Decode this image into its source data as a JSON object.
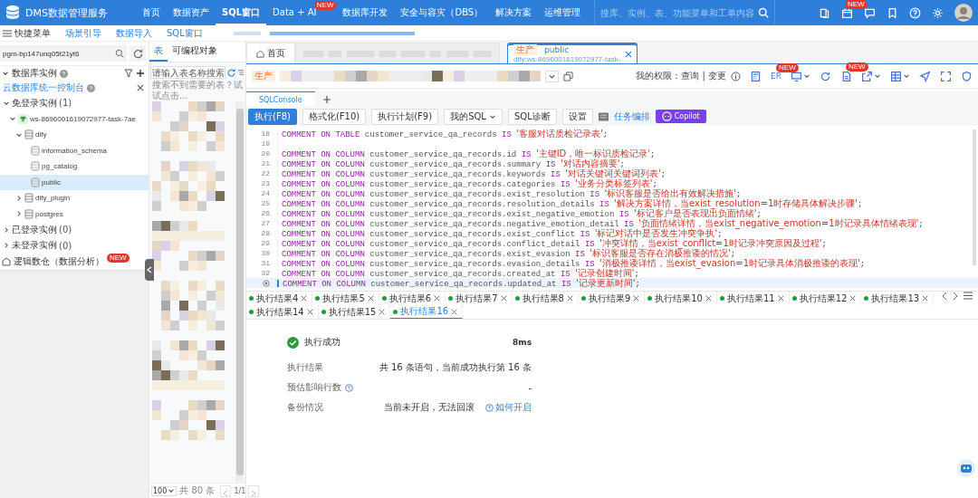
{
  "header": {
    "product": "DMS数据管理服务",
    "nav": [
      {
        "label": "首页",
        "selected": false
      },
      {
        "label": "数据资产",
        "selected": false
      },
      {
        "label": "SQL窗口",
        "selected": true
      },
      {
        "label": "Data + AI",
        "selected": false,
        "badge": "NEW"
      },
      {
        "label": "数据库开发",
        "selected": false
      },
      {
        "label": "安全与容灾（DBS）",
        "selected": false
      },
      {
        "label": "解决方案",
        "selected": false
      },
      {
        "label": "运维管理",
        "selected": false
      }
    ],
    "search": {
      "placeholder": "搜库、实例、表、功能菜单和工单内容"
    },
    "tools": [
      {
        "kind": "book"
      },
      {
        "kind": "calendar",
        "badge": "NEW"
      },
      {
        "kind": "chat"
      },
      {
        "kind": "bookmark"
      },
      {
        "kind": "help"
      },
      {
        "kind": "settings"
      }
    ]
  },
  "quickbar": {
    "menu": "快捷菜单",
    "links": [
      "场景引导",
      "数据导入",
      "SQL窗口"
    ]
  },
  "instance_picker": {
    "value": "pgm-bp147unq05t21yt6"
  },
  "instances": {
    "title": "数据库实例",
    "console_link": "云数据库统一控制台",
    "tree": [
      {
        "kind": "group",
        "label": "免登录实例",
        "count": "(1)",
        "expanded": true,
        "children": [
          {
            "kind": "instance",
            "label": "ws-8696001619072977-task-7ae",
            "expanded": true,
            "children": [
              {
                "kind": "database",
                "label": "dify",
                "expanded": true,
                "children": [
                  {
                    "kind": "schema",
                    "label": "information_schema",
                    "selected": false
                  },
                  {
                    "kind": "schema",
                    "label": "pg_catalog",
                    "selected": false
                  },
                  {
                    "kind": "schema",
                    "label": "public",
                    "selected": true
                  }
                ]
              },
              {
                "kind": "database",
                "label": "dify_plugin",
                "expanded": false
              },
              {
                "kind": "database",
                "label": "postgres",
                "expanded": false
              }
            ]
          }
        ]
      },
      {
        "kind": "group",
        "label": "已登录实例",
        "count": "(0)",
        "expanded": false
      },
      {
        "kind": "group",
        "label": "未登录实例",
        "count": "(0)",
        "expanded": false
      }
    ],
    "logical_warehouse": {
      "label": "逻辑数仓（数据分析）",
      "badge": "NEW"
    }
  },
  "tables": {
    "tabs": [
      {
        "label": "表",
        "selected": true
      },
      {
        "label": "可编程对象",
        "selected": false
      }
    ],
    "search": {
      "placeholder": "请输入表名称搜索"
    },
    "hint": "搜索不到需要的表？试试点击...",
    "page_size": "100",
    "total": "共 80 条",
    "page": "1/1"
  },
  "workspace_tabs": [
    {
      "kind": "home",
      "label": "首页",
      "selected": false
    },
    {
      "kind": "blurred",
      "selected": false
    },
    {
      "kind": "console",
      "env": "生产",
      "label": "public",
      "subtitle": "dify:ws-8696001619072977-task-",
      "selected": true
    }
  ],
  "context_bar": {
    "env": "生产",
    "permissions": "我的权限：查询 | 变更",
    "tools": [
      {
        "kind": "calculator",
        "dropdown": false
      },
      {
        "kind": "er",
        "label": "ER",
        "badge": "NEW",
        "dropdown": false
      },
      {
        "kind": "monitor",
        "dropdown": true
      },
      {
        "kind": "refresh",
        "dropdown": false
      },
      {
        "kind": "document",
        "badge": "NEW",
        "dropdown": false
      },
      {
        "kind": "export",
        "dropdown": true
      },
      {
        "kind": "table",
        "dropdown": true
      },
      {
        "kind": "send",
        "dropdown": false
      },
      {
        "kind": "fullscreen",
        "dropdown": false
      },
      {
        "kind": "shield",
        "dropdown": false
      }
    ]
  },
  "editor_tabs": [
    {
      "label": "SQLConsole",
      "selected": true
    }
  ],
  "actions": [
    {
      "kind": "primary",
      "label": "执行(F8)"
    },
    {
      "kind": "default",
      "label": "格式化(F10)"
    },
    {
      "kind": "default",
      "label": "执行计划(F9)"
    },
    {
      "kind": "dropdown",
      "label": "我的SQL"
    },
    {
      "kind": "default",
      "label": "SQL诊断"
    },
    {
      "kind": "default",
      "label": "设置"
    },
    {
      "kind": "icon"
    },
    {
      "kind": "link",
      "label": "任务编排"
    },
    {
      "kind": "copilot",
      "label": "Copilot"
    }
  ],
  "code": [
    {
      "number": "18",
      "current": false,
      "tokens": [
        {
          "kind": "kw",
          "text": "COMMENT ON TABLE"
        },
        {
          "kind": "id",
          "text": "customer_service_qa_records"
        },
        {
          "kind": "kw",
          "text": "IS"
        },
        {
          "kind": "str",
          "text": "'客服对话质检记录表'"
        },
        {
          "kind": "punct",
          "text": ";"
        }
      ]
    },
    {
      "number": "19",
      "current": false
    },
    {
      "number": "20",
      "current": false,
      "tokens": [
        {
          "kind": "kw",
          "text": "COMMENT ON COLUMN"
        },
        {
          "kind": "id",
          "text": "customer_service_qa_records.id"
        },
        {
          "kind": "kw",
          "text": "IS"
        },
        {
          "kind": "str",
          "text": "'主键ID，唯一标识质检记录'"
        },
        {
          "kind": "punct",
          "text": ";"
        }
      ]
    },
    {
      "number": "21",
      "current": false,
      "tokens": [
        {
          "kind": "kw",
          "text": "COMMENT ON COLUMN"
        },
        {
          "kind": "id",
          "text": "customer_service_qa_records.summary"
        },
        {
          "kind": "kw",
          "text": "IS"
        },
        {
          "kind": "str",
          "text": "'对话内容摘要'"
        },
        {
          "kind": "punct",
          "text": ";"
        }
      ]
    },
    {
      "number": "22",
      "current": false,
      "tokens": [
        {
          "kind": "kw",
          "text": "COMMENT ON COLUMN"
        },
        {
          "kind": "id",
          "text": "customer_service_qa_records.keywords"
        },
        {
          "kind": "kw",
          "text": "IS"
        },
        {
          "kind": "str",
          "text": "'对话关键词关键词列表'"
        },
        {
          "kind": "punct",
          "text": ";"
        }
      ]
    },
    {
      "number": "23",
      "current": false,
      "tokens": [
        {
          "kind": "kw",
          "text": "COMMENT ON COLUMN"
        },
        {
          "kind": "id",
          "text": "customer_service_qa_records.categories"
        },
        {
          "kind": "kw",
          "text": "IS"
        },
        {
          "kind": "str",
          "text": "'业务分类标签列表'"
        },
        {
          "kind": "punct",
          "text": ";"
        }
      ]
    },
    {
      "number": "24",
      "current": false,
      "tokens": [
        {
          "kind": "kw",
          "text": "COMMENT ON COLUMN"
        },
        {
          "kind": "id",
          "text": "customer_service_qa_records.exist_resolution"
        },
        {
          "kind": "kw",
          "text": "IS"
        },
        {
          "kind": "str",
          "text": "'标识客服是否给出有效解决措施'"
        },
        {
          "kind": "punct",
          "text": ";"
        }
      ]
    },
    {
      "number": "25",
      "current": false,
      "tokens": [
        {
          "kind": "kw",
          "text": "COMMENT ON COLUMN"
        },
        {
          "kind": "id",
          "text": "customer_service_qa_records.resolution_details"
        },
        {
          "kind": "kw",
          "text": "IS"
        },
        {
          "kind": "str",
          "text": "'解决方案详情，当exist_resolution=1时存储具体解决步骤'"
        },
        {
          "kind": "punct",
          "text": ";"
        }
      ]
    },
    {
      "number": "26",
      "current": false,
      "tokens": [
        {
          "kind": "kw",
          "text": "COMMENT ON COLUMN"
        },
        {
          "kind": "id",
          "text": "customer_service_qa_records.exist_negative_emotion"
        },
        {
          "kind": "kw",
          "text": "IS"
        },
        {
          "kind": "str",
          "text": "'标记客户是否表现出负面情绪'"
        },
        {
          "kind": "punct",
          "text": ";"
        }
      ]
    },
    {
      "number": "27",
      "current": false,
      "tokens": [
        {
          "kind": "kw",
          "text": "COMMENT ON COLUMN"
        },
        {
          "kind": "id",
          "text": "customer_service_qa_records.negative_emotion_detail"
        },
        {
          "kind": "kw",
          "text": "IS"
        },
        {
          "kind": "str",
          "text": "'负面情绪详情，当exist_negative_emotion=1时记录具体情绪表现'"
        },
        {
          "kind": "punct",
          "text": ";"
        }
      ]
    },
    {
      "number": "28",
      "current": false,
      "tokens": [
        {
          "kind": "kw",
          "text": "COMMENT ON COLUMN"
        },
        {
          "kind": "id",
          "text": "customer_service_qa_records.exist_conflict"
        },
        {
          "kind": "kw",
          "text": "IS"
        },
        {
          "kind": "str",
          "text": "'标记对话中是否发生冲突争执'"
        },
        {
          "kind": "punct",
          "text": ";"
        }
      ]
    },
    {
      "number": "29",
      "current": false,
      "tokens": [
        {
          "kind": "kw",
          "text": "COMMENT ON COLUMN"
        },
        {
          "kind": "id",
          "text": "customer_service_qa_records.conflict_detail"
        },
        {
          "kind": "kw",
          "text": "IS"
        },
        {
          "kind": "str",
          "text": "'冲突详情，当exist_conflict=1时记录冲突原因及过程'"
        },
        {
          "kind": "punct",
          "text": ";"
        }
      ]
    },
    {
      "number": "30",
      "current": false,
      "tokens": [
        {
          "kind": "kw",
          "text": "COMMENT ON COLUMN"
        },
        {
          "kind": "id",
          "text": "customer_service_qa_records.exist_evasion"
        },
        {
          "kind": "kw",
          "text": "IS"
        },
        {
          "kind": "str",
          "text": "'标识客服是否存在消极推诿的情况'"
        },
        {
          "kind": "punct",
          "text": ";"
        }
      ]
    },
    {
      "number": "31",
      "current": false,
      "tokens": [
        {
          "kind": "kw",
          "text": "COMMENT ON COLUMN"
        },
        {
          "kind": "id",
          "text": "customer_service_qa_records.evasion_details"
        },
        {
          "kind": "kw",
          "text": "IS"
        },
        {
          "kind": "str",
          "text": "'消极推诿详情，当exist_evasion=1时记录具体消极推诿的表现'"
        },
        {
          "kind": "punct",
          "text": ";"
        }
      ]
    },
    {
      "number": "32",
      "current": false,
      "tokens": [
        {
          "kind": "kw",
          "text": "COMMENT ON COLUMN"
        },
        {
          "kind": "id",
          "text": "customer_service_qa_records.created_at"
        },
        {
          "kind": "kw",
          "text": "IS"
        },
        {
          "kind": "str",
          "text": "'记录创建时间'"
        },
        {
          "kind": "punct",
          "text": ";"
        }
      ]
    },
    {
      "current": true,
      "tokens": [
        {
          "kind": "kw",
          "text": "COMMENT ON COLUMN"
        },
        {
          "kind": "id",
          "text": "customer_service_qa_records.updated_at"
        },
        {
          "kind": "kw",
          "text": "IS"
        },
        {
          "kind": "str",
          "text": "'记录更新时间'"
        },
        {
          "kind": "punct",
          "text": ";"
        }
      ]
    }
  ],
  "result_tabs": [
    {
      "label": "执行结果4",
      "selected": false
    },
    {
      "label": "执行结果5",
      "selected": false
    },
    {
      "label": "执行结果6",
      "selected": false
    },
    {
      "label": "执行结果7",
      "selected": false
    },
    {
      "label": "执行结果8",
      "selected": false
    },
    {
      "label": "执行结果9",
      "selected": false
    },
    {
      "label": "执行结果10",
      "selected": false
    },
    {
      "label": "执行结果11",
      "selected": false
    },
    {
      "label": "执行结果12",
      "selected": false
    },
    {
      "label": "执行结果13",
      "selected": false
    },
    {
      "label": "执行结果14",
      "selected": false
    },
    {
      "label": "执行结果15",
      "selected": false
    },
    {
      "label": "执行结果16",
      "selected": true
    }
  ],
  "result": {
    "status": "执行成功",
    "duration": "8ms",
    "rows": [
      {
        "label": "执行结果",
        "help": false,
        "value": "共 16 条语句，当前成功执行第 16 条"
      },
      {
        "label": "预估影响行数",
        "help": true,
        "value": "-"
      },
      {
        "label": "备份情况",
        "help": false,
        "value": "当前未开启，无法回滚",
        "link": "如何开启"
      }
    ]
  }
}
